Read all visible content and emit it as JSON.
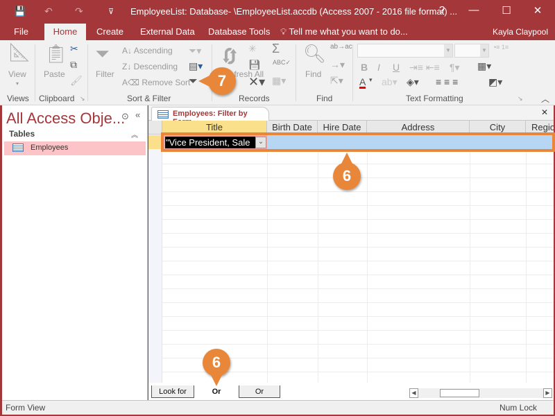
{
  "window": {
    "title": "EmployeeList: Database- \\EmployeeList.accdb (Access 2007 - 2016 file format) ...",
    "help": "?",
    "minimize": "—",
    "maximize": "☐",
    "close": "✕"
  },
  "quick_access": {
    "save": "💾",
    "undo": "↶",
    "redo": "↷",
    "customize": "⊽"
  },
  "ribbon_tabs": [
    {
      "label": "File"
    },
    {
      "label": "Home"
    },
    {
      "label": "Create"
    },
    {
      "label": "External Data"
    },
    {
      "label": "Database Tools"
    }
  ],
  "tell_me": "Tell me what you want to do...",
  "user_name": "Kayla Claypool",
  "ribbon": {
    "views": {
      "view_label": "View",
      "group": "Views"
    },
    "clipboard": {
      "paste_label": "Paste",
      "group": "Clipboard"
    },
    "sort_filter": {
      "filter_label": "Filter",
      "ascending": "Ascending",
      "descending": "Descending",
      "remove_sort": "Remove Sort",
      "group": "Sort & Filter"
    },
    "records": {
      "refresh_label": "Refresh All",
      "group": "Records"
    },
    "find": {
      "find_label": "Find",
      "group": "Find"
    },
    "text_formatting": {
      "group": "Text Formatting",
      "bold": "B",
      "italic": "I",
      "underline": "U"
    }
  },
  "nav_pane": {
    "title": "All Access Obje...",
    "section": "Tables",
    "items": [
      {
        "label": "Employees"
      }
    ]
  },
  "document": {
    "tab_label": "Employees: Filter by Form",
    "close": "✕",
    "columns": [
      "Title",
      "Birth Date",
      "Hire Date",
      "Address",
      "City",
      "Regio"
    ],
    "criteria_value": "\"Vice President, Sale",
    "dropdown_glyph": "⌄"
  },
  "bottom_tabs": [
    {
      "label": "Look for"
    },
    {
      "label": "Or"
    },
    {
      "label": "Or"
    }
  ],
  "status_bar": {
    "left": "Form View",
    "right": "Num Lock"
  },
  "callouts": [
    {
      "label": "7"
    },
    {
      "label": "6"
    },
    {
      "label": "6"
    }
  ],
  "colors": {
    "accent": "#a4373a",
    "callout": "#e8873a",
    "criteria_row": "#b7d6f3",
    "active_header": "#fbe08b",
    "nav_selected": "#fcc4c6"
  }
}
